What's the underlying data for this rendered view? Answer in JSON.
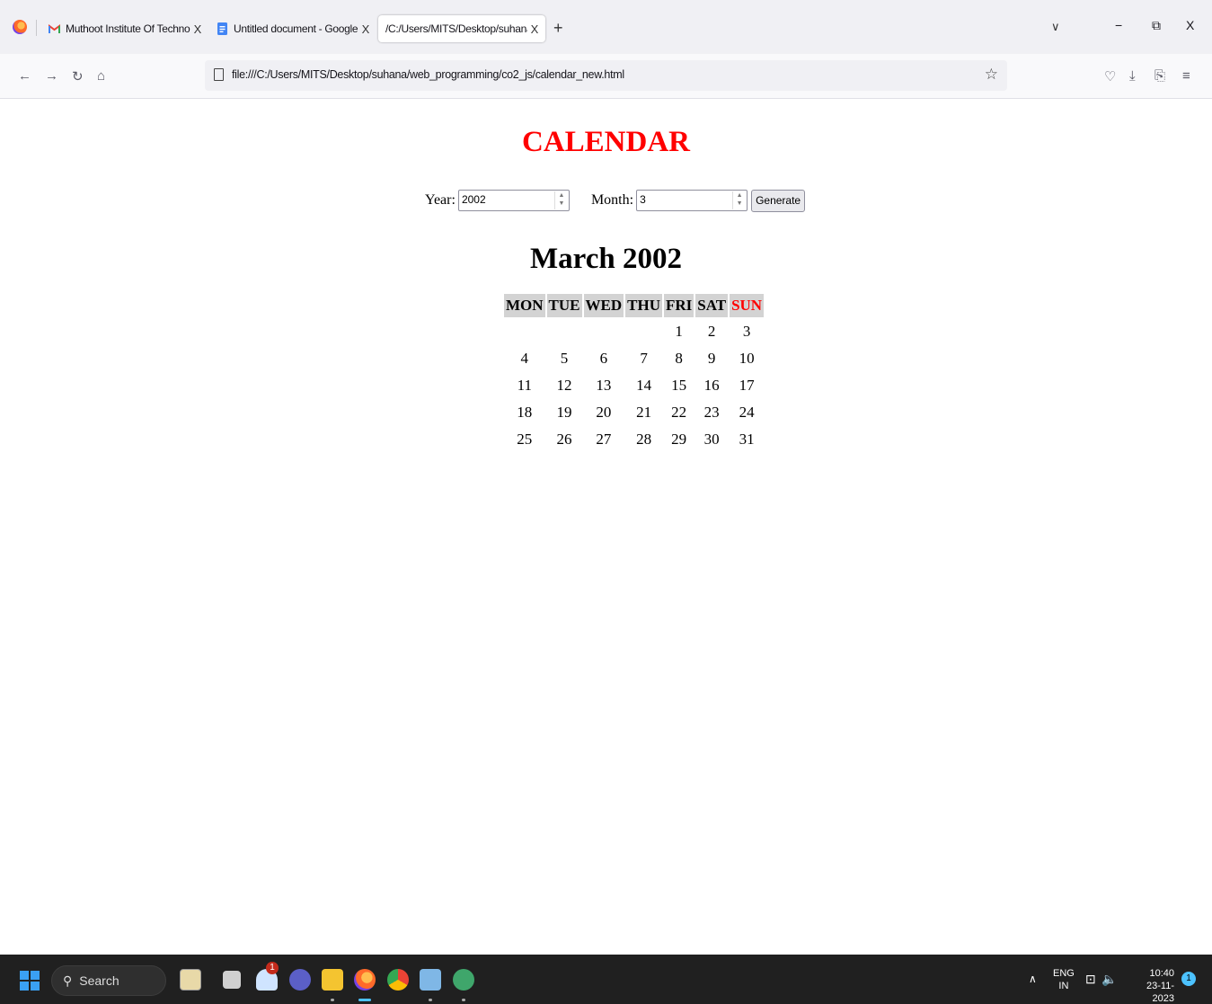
{
  "browser": {
    "tabs": [
      {
        "title": "Muthoot Institute Of Technolog",
        "close": "X",
        "icon": "gmail-icon"
      },
      {
        "title": "Untitled document - Google Do",
        "close": "X",
        "icon": "docs-icon"
      },
      {
        "title": "/C:/Users/MITS/Desktop/suhana/we",
        "close": "X",
        "active": true
      }
    ],
    "new_tab": "+",
    "tab_list": "∨",
    "window_controls": {
      "minimize": "−",
      "restore": "⧉",
      "close": "X"
    },
    "url": "file:///C:/Users/MITS/Desktop/suhana/web_programming/co2_js/calendar_new.html"
  },
  "page": {
    "heading": "CALENDAR",
    "year_label": "Year:",
    "year_value": "2002",
    "month_label": "Month:",
    "month_value": "3",
    "generate_label": "Generate",
    "month_title": "March 2002",
    "weekday_headers": [
      "MON",
      "TUE",
      "WED",
      "THU",
      "FRI",
      "SAT",
      "SUN"
    ],
    "weeks": [
      [
        "",
        "",
        "",
        "",
        "1",
        "2",
        "3"
      ],
      [
        "4",
        "5",
        "6",
        "7",
        "8",
        "9",
        "10"
      ],
      [
        "11",
        "12",
        "13",
        "14",
        "15",
        "16",
        "17"
      ],
      [
        "18",
        "19",
        "20",
        "21",
        "22",
        "23",
        "24"
      ],
      [
        "25",
        "26",
        "27",
        "28",
        "29",
        "30",
        "31"
      ]
    ],
    "colors": {
      "heading": "#ff0000",
      "sunday": "#ff0000",
      "header_bg": "#d3d3d3"
    }
  },
  "taskbar": {
    "search_label": "Search",
    "chat_badge": "1",
    "lang_line1": "ENG",
    "lang_line2": "IN",
    "time": "10:40",
    "date": "23-11-2023",
    "notification_count": "1"
  }
}
